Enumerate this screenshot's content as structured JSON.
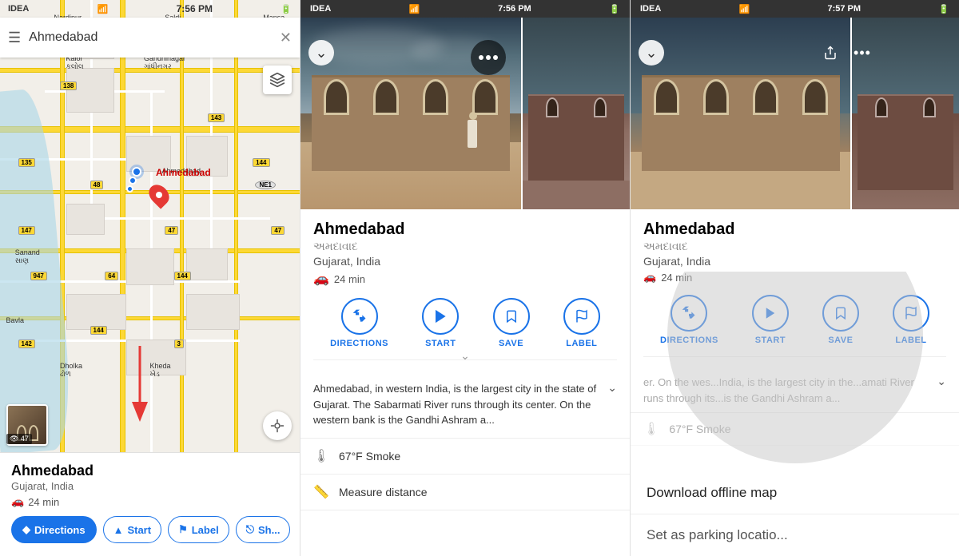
{
  "panel1": {
    "status": {
      "carrier": "IDEA",
      "wifi": "wifi",
      "time": "7:56 PM",
      "battery": "battery"
    },
    "search": {
      "placeholder": "Ahmedabad",
      "value": "Ahmedabad"
    },
    "place": {
      "name": "Ahmedabad",
      "region": "Gujarat, India",
      "travel_time": "24 min"
    },
    "actions": {
      "directions": "Directions",
      "start": "Start",
      "label": "Label",
      "share": "Sh..."
    }
  },
  "panel2": {
    "status": {
      "carrier": "IDEA",
      "wifi": "wifi",
      "time": "7:56 PM"
    },
    "place": {
      "name": "Ahmedabad",
      "name_local": "અમદાવાદ",
      "region": "Gujarat, India",
      "travel_time": "24 min"
    },
    "actions": {
      "directions": "DIRECTIONS",
      "start": "START",
      "save": "SAVE",
      "label": "LABEL"
    },
    "description": "Ahmedabad, in western India, is the largest city in the state of Gujarat. The Sabarmati River runs through its center. On the western bank is the Gandhi Ashram a...",
    "info_rows": [
      {
        "icon": "temp",
        "text": "67°F Smoke"
      },
      {
        "icon": "ruler",
        "text": "Measure distance"
      }
    ]
  },
  "panel3": {
    "status": {
      "carrier": "IDEA",
      "wifi": "wifi",
      "time": "7:57 PM"
    },
    "place": {
      "name": "Ahmedabad",
      "name_local": "અમદાવાદ",
      "region": "Gujarat, India",
      "travel_time": "24 min"
    },
    "actions": {
      "directions": "DIRECTIONS",
      "start": "START",
      "save": "SAVE",
      "label": "LABEL"
    },
    "description_partial": "er. On the wes...India, is the largest city in the...amati River runs through its...is the Gandhi Ashram a...",
    "info_partial": "67°F Smoke",
    "menu": {
      "items": [
        "Download offline map",
        "Set as parking locatio..."
      ]
    }
  }
}
